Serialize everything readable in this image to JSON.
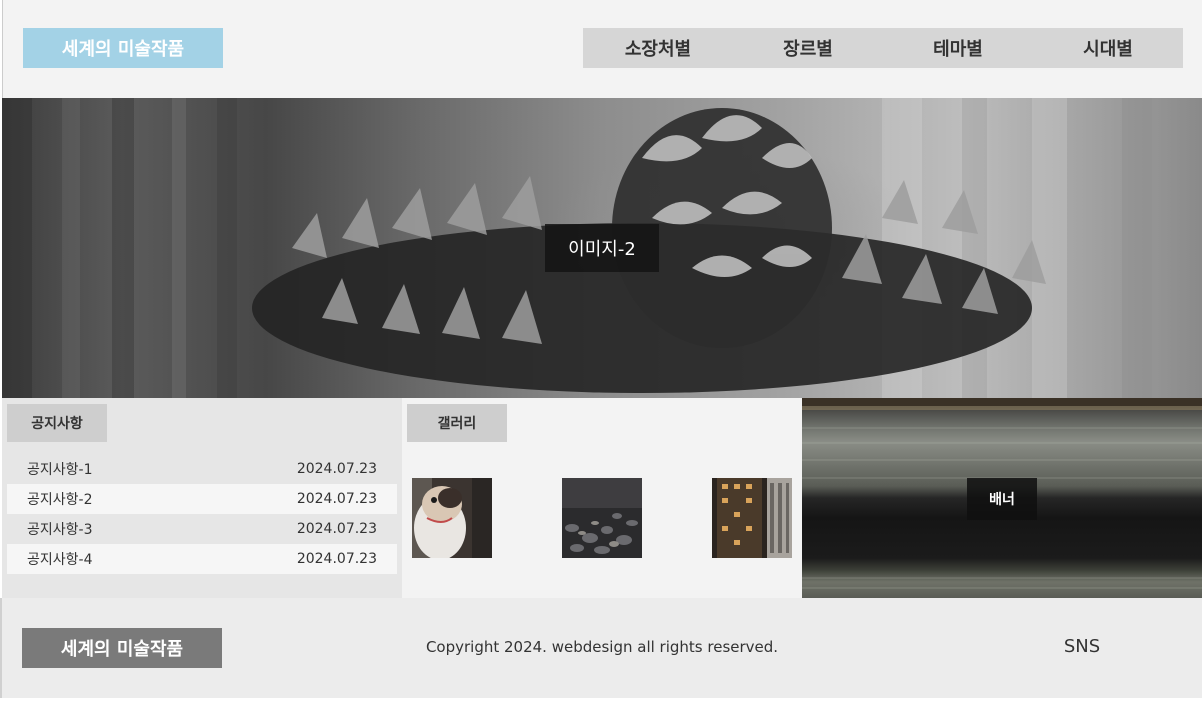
{
  "header": {
    "logo": "세계의 미술작품",
    "nav": [
      "소장처별",
      "장르별",
      "테마별",
      "시대별"
    ]
  },
  "slider": {
    "caption": "이미지-2"
  },
  "notice": {
    "title": "공지사항",
    "items": [
      {
        "title": "공지사항-1",
        "date": "2024.07.23"
      },
      {
        "title": "공지사항-2",
        "date": "2024.07.23"
      },
      {
        "title": "공지사항-3",
        "date": "2024.07.23"
      },
      {
        "title": "공지사항-4",
        "date": "2024.07.23"
      }
    ]
  },
  "gallery": {
    "title": "갤러리",
    "images": [
      "dog-photo",
      "pebbles-photo",
      "building-photo"
    ]
  },
  "banner": {
    "caption": "배너"
  },
  "footer": {
    "logo": "세계의 미술작품",
    "copyright": "Copyright 2024. webdesign all rights reserved.",
    "sns": "SNS"
  },
  "colors": {
    "logo_bg": "#a3d2e6",
    "nav_bg": "#d6d6d6",
    "footer_logo_bg": "#7a7a7a"
  }
}
